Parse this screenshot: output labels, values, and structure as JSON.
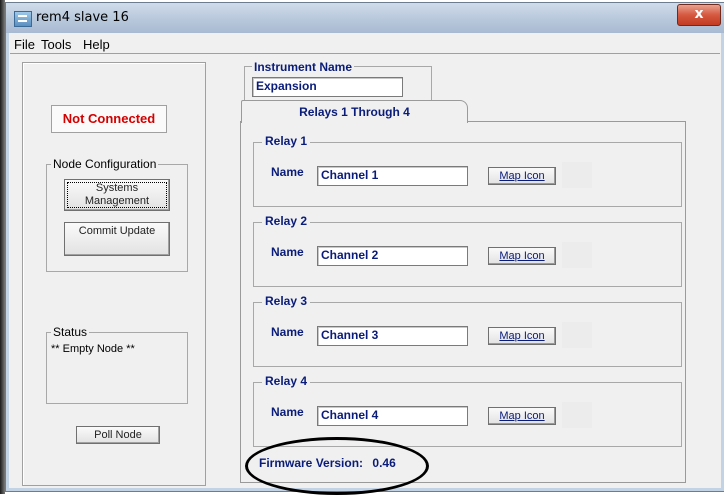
{
  "window": {
    "title": "rem4 slave 16",
    "close_label": "x"
  },
  "menu": {
    "items": [
      "File",
      "Tools",
      "Help"
    ]
  },
  "left": {
    "connection_status": "Not Connected",
    "node_config": {
      "legend": "Node Configuration",
      "systems_management_label": "Systems Management",
      "commit_update_label": "Commit Update"
    },
    "status": {
      "legend": "Status",
      "text": "** Empty Node **"
    },
    "poll_node_label": "Poll Node"
  },
  "instrument": {
    "legend": "Instrument Name",
    "value": "Expansion"
  },
  "tab": {
    "label": "Relays 1 Through 4"
  },
  "relays": [
    {
      "legend": "Relay 1",
      "name_label": "Name",
      "name_value": "Channel 1",
      "map_icon_label": "Map Icon"
    },
    {
      "legend": "Relay 2",
      "name_label": "Name",
      "name_value": "Channel 2",
      "map_icon_label": "Map Icon"
    },
    {
      "legend": "Relay 3",
      "name_label": "Name",
      "name_value": "Channel 3",
      "map_icon_label": "Map Icon"
    },
    {
      "legend": "Relay 4",
      "name_label": "Name",
      "name_value": "Channel 4",
      "map_icon_label": "Map Icon"
    }
  ],
  "firmware": {
    "label": "Firmware Version:",
    "value": "0.46"
  }
}
